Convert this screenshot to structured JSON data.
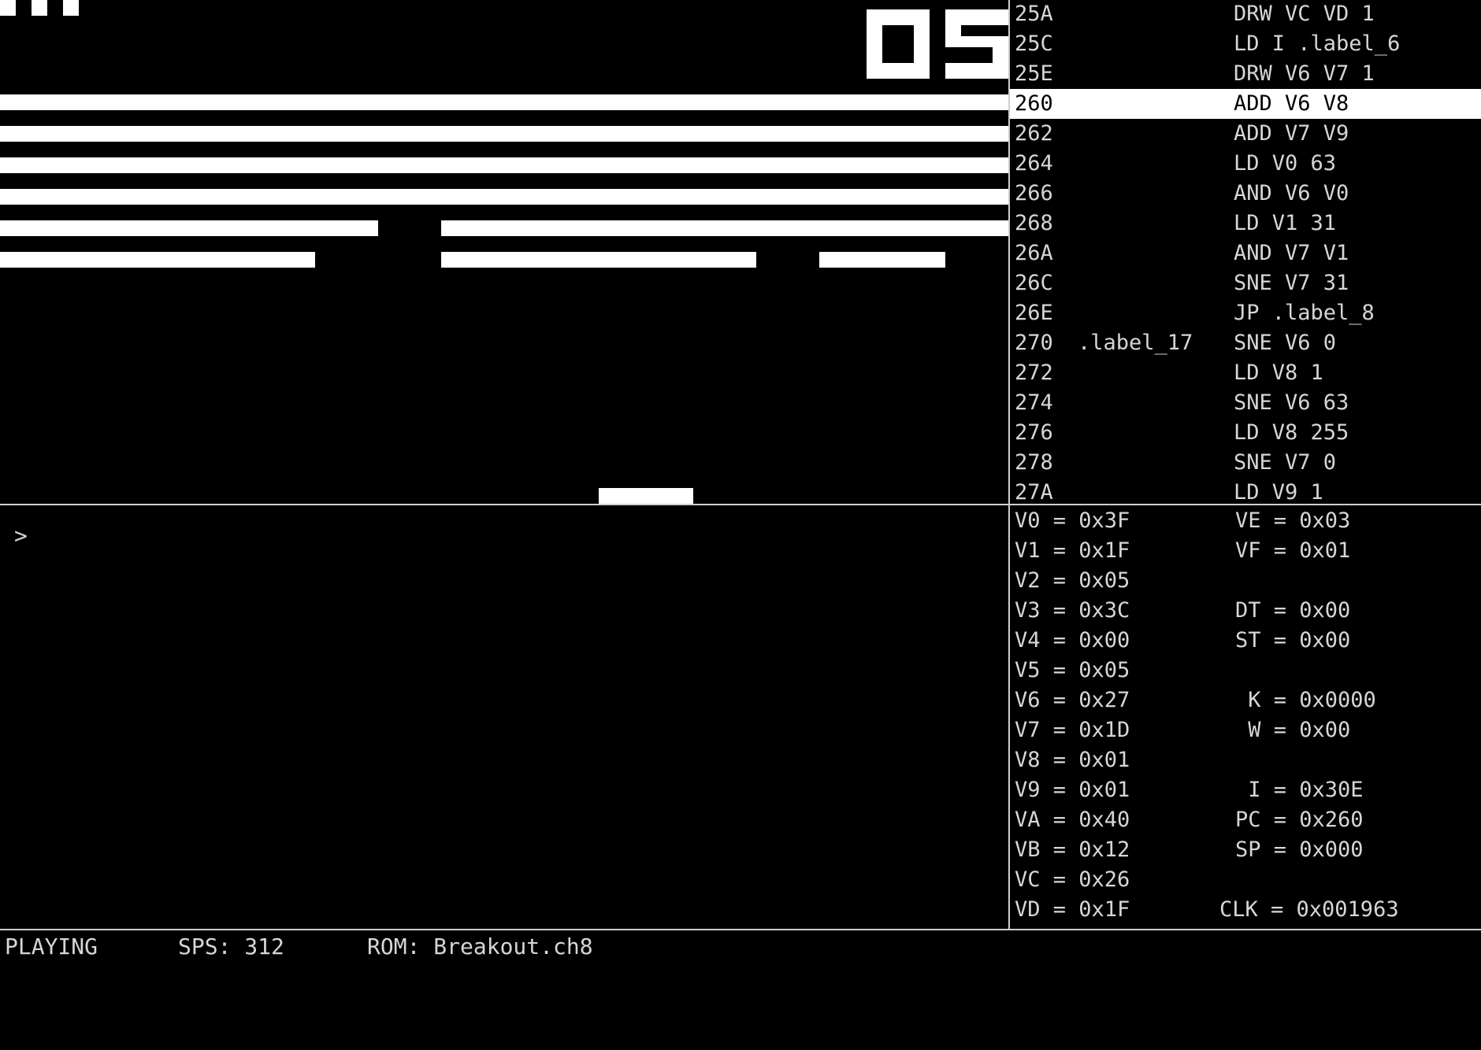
{
  "game": {
    "score": "05"
  },
  "disassembly": {
    "current_address": "260",
    "rows": [
      {
        "addr": "25A",
        "label": "",
        "instr": "DRW VC VD 1"
      },
      {
        "addr": "25C",
        "label": "",
        "instr": "LD I .label_6"
      },
      {
        "addr": "25E",
        "label": "",
        "instr": "DRW V6 V7 1"
      },
      {
        "addr": "260",
        "label": "",
        "instr": "ADD V6 V8"
      },
      {
        "addr": "262",
        "label": "",
        "instr": "ADD V7 V9"
      },
      {
        "addr": "264",
        "label": "",
        "instr": "LD V0 63"
      },
      {
        "addr": "266",
        "label": "",
        "instr": "AND V6 V0"
      },
      {
        "addr": "268",
        "label": "",
        "instr": "LD V1 31"
      },
      {
        "addr": "26A",
        "label": "",
        "instr": "AND V7 V1"
      },
      {
        "addr": "26C",
        "label": "",
        "instr": "SNE V7 31"
      },
      {
        "addr": "26E",
        "label": "",
        "instr": "JP .label_8"
      },
      {
        "addr": "270",
        "label": ".label_17",
        "instr": "SNE V6 0"
      },
      {
        "addr": "272",
        "label": "",
        "instr": "LD V8 1"
      },
      {
        "addr": "274",
        "label": "",
        "instr": "SNE V6 63"
      },
      {
        "addr": "276",
        "label": "",
        "instr": "LD V8 255"
      },
      {
        "addr": "278",
        "label": "",
        "instr": "SNE V7 0"
      },
      {
        "addr": "27A",
        "label": "",
        "instr": "LD V9 1"
      }
    ]
  },
  "console": {
    "prompt": ">"
  },
  "registers": {
    "left": [
      "V0 = 0x3F",
      "V1 = 0x1F",
      "V2 = 0x05",
      "V3 = 0x3C",
      "V4 = 0x00",
      "V5 = 0x05",
      "V6 = 0x27",
      "V7 = 0x1D",
      "V8 = 0x01",
      "V9 = 0x01",
      "VA = 0x40",
      "VB = 0x12",
      "VC = 0x26",
      "VD = 0x1F"
    ],
    "right": [
      "VE = 0x03",
      "VF = 0x01",
      "",
      "DT = 0x00",
      "ST = 0x00",
      "",
      " K = 0x0000",
      " W = 0x00",
      "",
      " I = 0x30E",
      "PC = 0x260",
      "SP = 0x000",
      "",
      "CLK = 0x001963"
    ]
  },
  "status": {
    "state": "PLAYING",
    "sps": "SPS: 312",
    "rom": "ROM: Breakout.ch8"
  },
  "colors": {
    "background": "#000000",
    "foreground": "#ffffff",
    "text": "#d6d6d6"
  }
}
